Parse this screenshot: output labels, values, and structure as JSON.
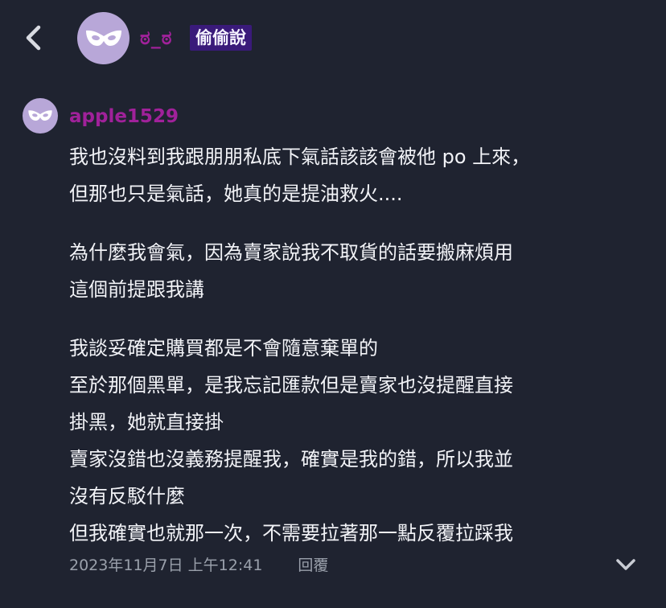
{
  "header": {
    "back_icon": "chevron-left-icon",
    "avatar_icon": "mask-icon",
    "author_name": "ಠ_ಠ",
    "badge_label": "偷偷說"
  },
  "comment": {
    "avatar_icon": "mask-icon",
    "author": "apple1529",
    "paragraphs": [
      [
        "我也沒料到我跟朋朋私底下氣話該該會被他 po 上來，",
        "但那也只是氣話，她真的是提油救火...."
      ],
      [
        "為什麼我會氣，因為賣家說我不取貨的話要搬麻煩用",
        "這個前提跟我講"
      ],
      [
        "我談妥確定購買都是不會隨意棄單的",
        "至於那個黑單，是我忘記匯款但是賣家也沒提醒直接",
        "掛黑，她就直接掛",
        "賣家沒錯也沒義務提醒我，確實是我的錯，所以我並",
        "沒有反駁什麼",
        "但我確實也就那一次，不需要拉著那一點反覆拉踩我"
      ]
    ],
    "timestamp": "2023年11月7日 上午12:41",
    "reply_label": "回覆",
    "expand_icon": "chevron-down-icon"
  },
  "colors": {
    "background": "#1f2330",
    "author_color": "#a0219a",
    "badge_bg": "#3a1a7a",
    "avatar_bg": "#b8a7d8",
    "text": "#f2f3f7",
    "muted": "#9aa0ab"
  }
}
